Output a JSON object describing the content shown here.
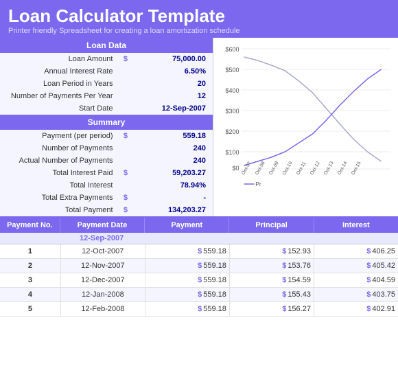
{
  "header": {
    "title": "Loan Calculator Template",
    "subtitle": "Printer friendly Spreadsheet for creating a loan amortization schedule"
  },
  "loan_data": {
    "section_label": "Loan Data",
    "fields": [
      {
        "label": "Loan Amount",
        "dollar": "$",
        "value": "75,000.00"
      },
      {
        "label": "Annual Interest Rate",
        "dollar": "",
        "value": "6.50%"
      },
      {
        "label": "Loan Period in Years",
        "dollar": "",
        "value": "20"
      },
      {
        "label": "Number of Payments Per Year",
        "dollar": "",
        "value": "12"
      },
      {
        "label": "Start Date",
        "dollar": "",
        "value": "12-Sep-2007"
      }
    ]
  },
  "summary": {
    "section_label": "Summary",
    "fields": [
      {
        "label": "Payment (per period)",
        "dollar": "$",
        "value": "559.18"
      },
      {
        "label": "Number of Payments",
        "dollar": "",
        "value": "240"
      },
      {
        "label": "Actual Number of Payments",
        "dollar": "",
        "value": "240"
      },
      {
        "label": "Total Interest Paid",
        "dollar": "$",
        "value": "59,203.27"
      },
      {
        "label": "Total Interest",
        "dollar": "",
        "value": "78.94%"
      },
      {
        "label": "Total Extra Payments",
        "dollar": "$",
        "value": "-"
      },
      {
        "label": "Total Payment",
        "dollar": "$",
        "value": "134,203.27"
      }
    ]
  },
  "amort_table": {
    "headers": [
      "Payment No.",
      "Payment Date",
      "Payment",
      "Principal",
      "Interest"
    ],
    "start_date": "12-Sep-2007",
    "rows": [
      {
        "no": "1",
        "date": "12-Oct-2007",
        "payment": "559.18",
        "principal": "152.93",
        "interest": "406.25"
      },
      {
        "no": "2",
        "date": "12-Nov-2007",
        "payment": "559.18",
        "principal": "153.76",
        "interest": "405.42"
      },
      {
        "no": "3",
        "date": "12-Dec-2007",
        "payment": "559.18",
        "principal": "154.59",
        "interest": "404.59"
      },
      {
        "no": "4",
        "date": "12-Jan-2008",
        "payment": "559.18",
        "principal": "155.43",
        "interest": "403.75"
      },
      {
        "no": "5",
        "date": "12-Feb-2008",
        "payment": "559.18",
        "principal": "156.27",
        "interest": "402.91"
      }
    ]
  },
  "chart": {
    "y_labels": [
      "$600",
      "$500",
      "$400",
      "$300",
      "$200",
      "$100",
      "$0"
    ],
    "x_labels": [
      "Oct-07",
      "Oct-08",
      "Oct-09",
      "Oct-10",
      "Oct-11",
      "Oct-12",
      "Oct-13",
      "Oct-14",
      "Oct-15"
    ],
    "legend": "Pr"
  },
  "colors": {
    "accent": "#7b68ee",
    "principal_line": "#5a5aaa",
    "interest_line": "#888"
  }
}
